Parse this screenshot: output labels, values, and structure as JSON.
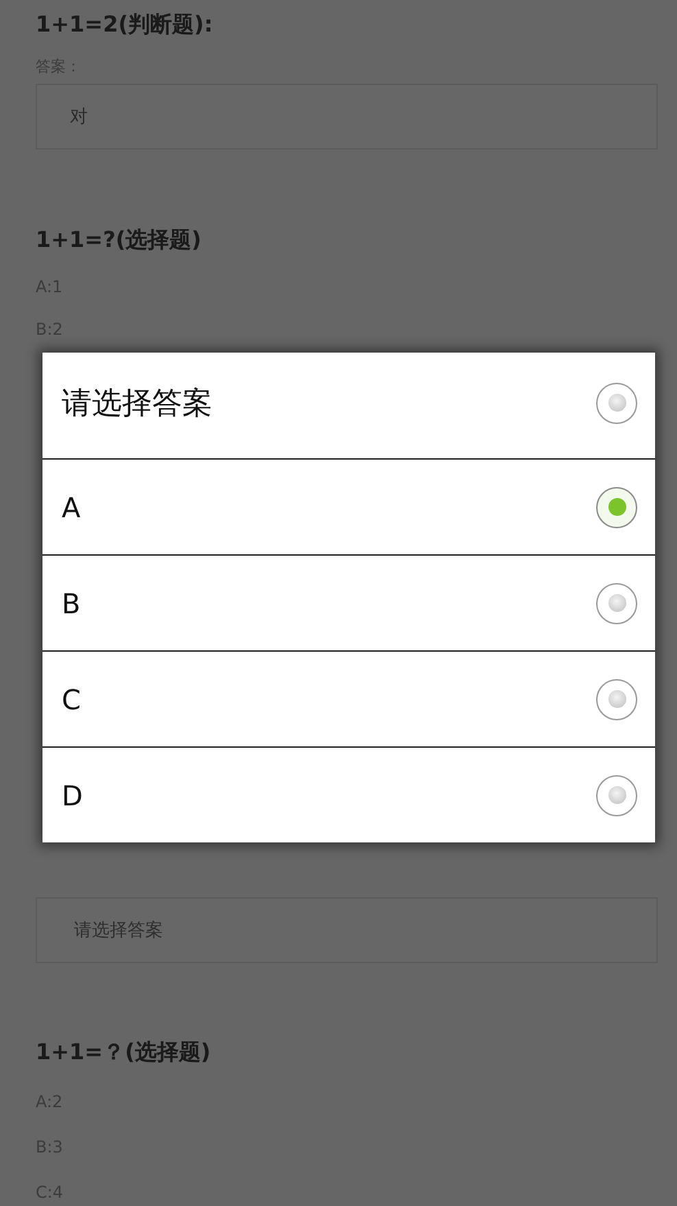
{
  "questions": [
    {
      "title": "1+1=2(判断题):",
      "answer_label": "答案：",
      "answer": "对"
    },
    {
      "title": "1+1=?(选择题)",
      "options": [
        "A:1",
        "B:2"
      ],
      "answer_placeholder": "请选择答案"
    },
    {
      "title": "1+1=？(选择题)",
      "options": [
        "A:2",
        "B:3",
        "C:4"
      ]
    }
  ],
  "dialog": {
    "options": [
      {
        "label": "请选择答案",
        "selected": false
      },
      {
        "label": "A",
        "selected": true
      },
      {
        "label": "B",
        "selected": false
      },
      {
        "label": "C",
        "selected": false
      },
      {
        "label": "D",
        "selected": false
      }
    ]
  }
}
